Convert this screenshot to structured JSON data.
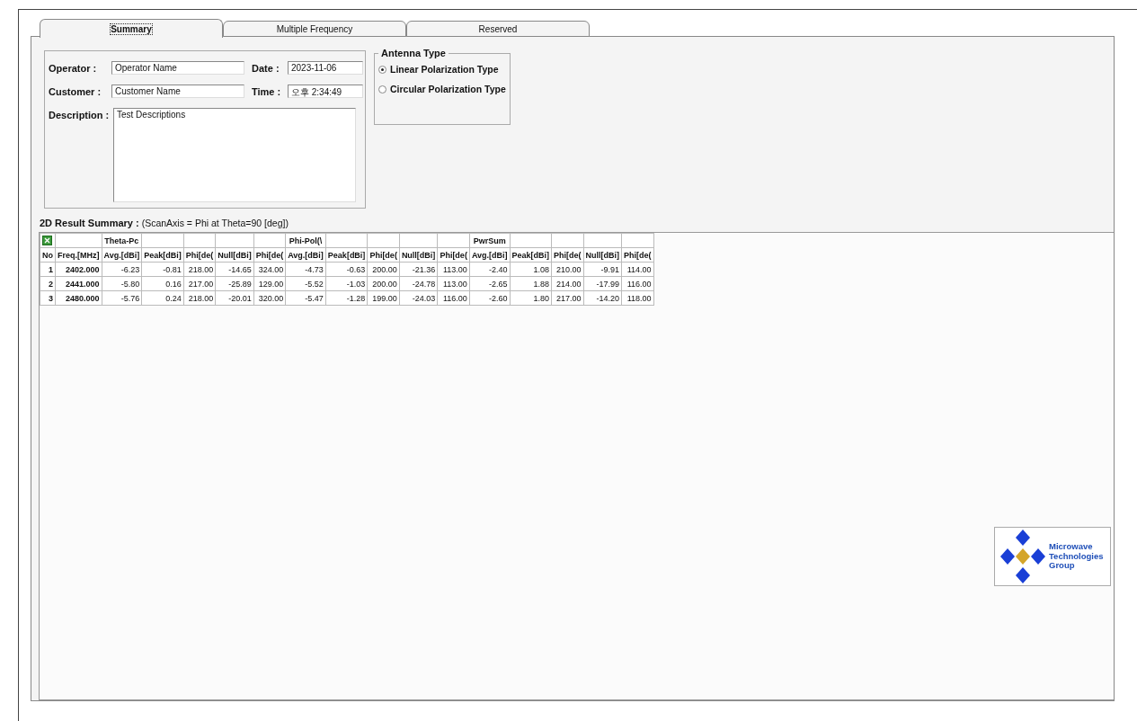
{
  "tabs": [
    {
      "label": "Summary",
      "selected": true
    },
    {
      "label": "Multiple Frequency",
      "selected": false
    },
    {
      "label": "Reserved",
      "selected": false
    }
  ],
  "info": {
    "operator": {
      "label": "Operator :",
      "value": "Operator Name"
    },
    "date": {
      "label": "Date :",
      "value": "2023-11-06"
    },
    "customer": {
      "label": "Customer :",
      "value": "Customer Name"
    },
    "time": {
      "label": "Time :",
      "value": "오후 2:34:49"
    },
    "description": {
      "label": "Description :",
      "value": "Test Descriptions"
    }
  },
  "antenna_type": {
    "title": "Antenna Type",
    "options": [
      {
        "label": "Linear Polarization Type",
        "selected": true
      },
      {
        "label": "Circular Polarization Type",
        "selected": false
      }
    ]
  },
  "result_summary": {
    "label": "2D Result Summary :",
    "note": "(ScanAxis = Phi at Theta=90 [deg])"
  },
  "table": {
    "columns": [
      {
        "label": "No"
      },
      {
        "label": "Freq.[MHz]"
      },
      {
        "group": "Theta-Pc",
        "label": "Avg.[dBi]"
      },
      {
        "label": "Peak[dBi]"
      },
      {
        "label": "Phi[de("
      },
      {
        "label": "Null[dBi]"
      },
      {
        "label": "Phi[de("
      },
      {
        "group": "Phi-Pol(\\",
        "label": "Avg.[dBi]"
      },
      {
        "label": "Peak[dBi]"
      },
      {
        "label": "Phi[de("
      },
      {
        "label": "Null[dBi]"
      },
      {
        "label": "Phi[de("
      },
      {
        "group": "PwrSum",
        "label": "Avg.[dBi]"
      },
      {
        "label": "Peak[dBi]"
      },
      {
        "label": "Phi[de("
      },
      {
        "label": "Null[dBi]"
      },
      {
        "label": "Phi[de("
      }
    ],
    "rows": [
      [
        "1",
        "2402.000",
        "-6.23",
        "-0.81",
        "218.00",
        "-14.65",
        "324.00",
        "-4.73",
        "-0.63",
        "200.00",
        "-21.36",
        "113.00",
        "-2.40",
        "1.08",
        "210.00",
        "-9.91",
        "114.00"
      ],
      [
        "2",
        "2441.000",
        "-5.80",
        "0.16",
        "217.00",
        "-25.89",
        "129.00",
        "-5.52",
        "-1.03",
        "200.00",
        "-24.78",
        "113.00",
        "-2.65",
        "1.88",
        "214.00",
        "-17.99",
        "116.00"
      ],
      [
        "3",
        "2480.000",
        "-5.76",
        "0.24",
        "218.00",
        "-20.01",
        "320.00",
        "-5.47",
        "-1.28",
        "199.00",
        "-24.03",
        "116.00",
        "-2.60",
        "1.80",
        "217.00",
        "-14.20",
        "118.00"
      ]
    ]
  },
  "logo": {
    "text": "Microwave Technologies Group"
  }
}
